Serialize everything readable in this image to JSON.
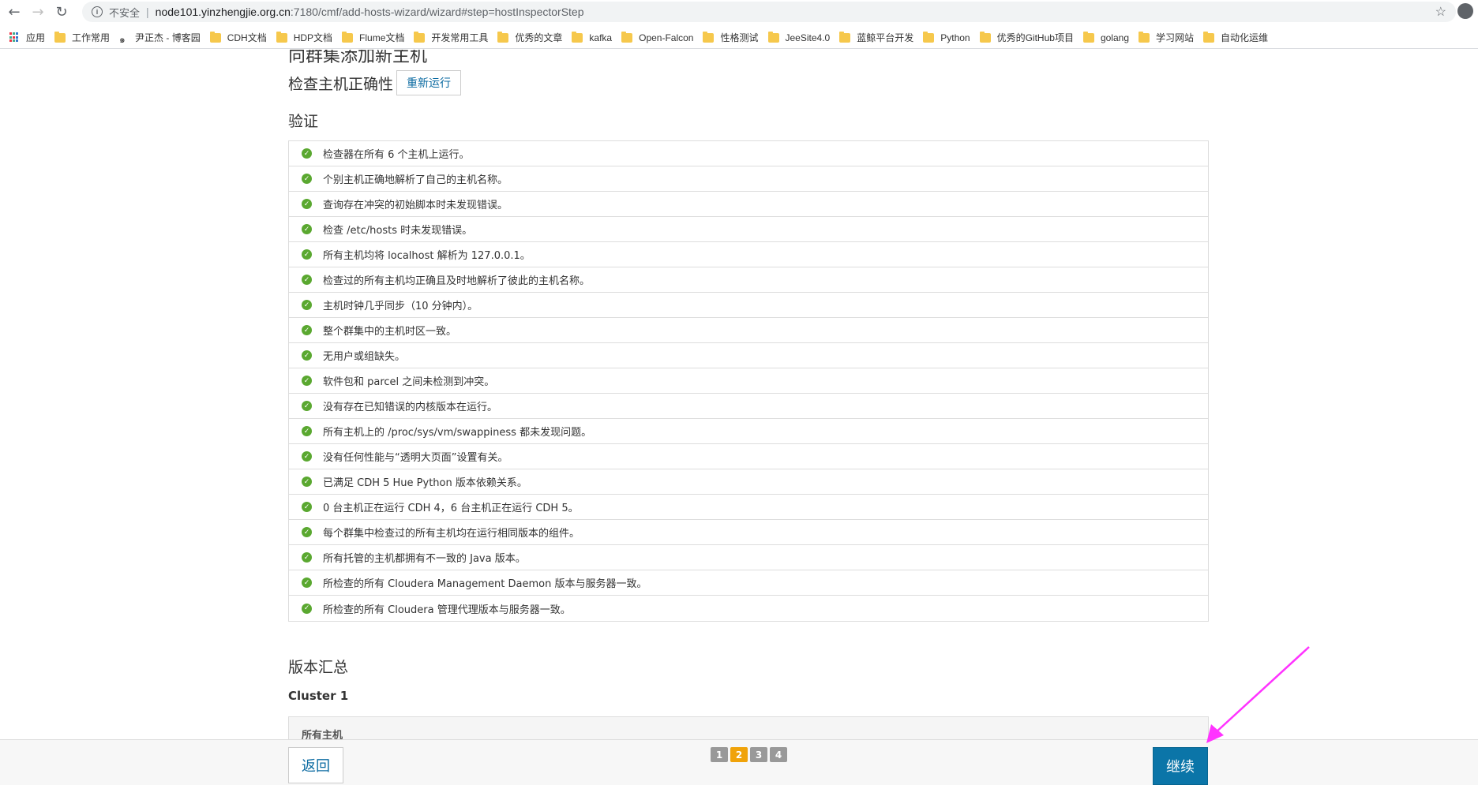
{
  "browser": {
    "insecure_label": "不安全",
    "url_host": "node101.yinzhengjie.org.cn",
    "url_path": ":7180/cmf/add-hosts-wizard/wizard#step=hostInspectorStep"
  },
  "bookmarks": [
    "应用",
    "工作常用",
    "尹正杰 - 博客园",
    "CDH文档",
    "HDP文档",
    "Flume文档",
    "开发常用工具",
    "优秀的文章",
    "kafka",
    "Open-Falcon",
    "性格测试",
    "JeeSite4.0",
    "蓝鲸平台开发",
    "Python",
    "优秀的GitHub项目",
    "golang",
    "学习网站",
    "自动化运维"
  ],
  "page": {
    "title": "向群集添加新主机",
    "subtitle": "检查主机正确性",
    "rerun_label": "重新运行",
    "validation_heading": "验证",
    "checks": [
      "检查器在所有 6 个主机上运行。",
      "个别主机正确地解析了自己的主机名称。",
      "查询存在冲突的初始脚本时未发现错误。",
      "检查 /etc/hosts 时未发现错误。",
      "所有主机均将 localhost 解析为 127.0.0.1。",
      "检查过的所有主机均正确且及时地解析了彼此的主机名称。",
      "主机时钟几乎同步（10 分钟内）。",
      "整个群集中的主机时区一致。",
      "无用户或组缺失。",
      "软件包和 parcel 之间未检测到冲突。",
      "没有存在已知错误的内核版本在运行。",
      "所有主机上的 /proc/sys/vm/swappiness 都未发现问题。",
      "没有任何性能与“透明大页面”设置有关。",
      "已满足 CDH 5 Hue Python 版本依赖关系。",
      "0 台主机正在运行 CDH 4，6 台主机正在运行 CDH 5。",
      "每个群集中检查过的所有主机均在运行相同版本的组件。",
      "所有托管的主机都拥有不一致的 Java 版本。",
      "所检查的所有 Cloudera Management Daemon 版本与服务器一致。",
      "所检查的所有 Cloudera 管理代理版本与服务器一致。"
    ],
    "version_heading": "版本汇总",
    "cluster_name": "Cluster 1",
    "all_hosts_label": "所有主机"
  },
  "footer": {
    "back_label": "返回",
    "continue_label": "继续",
    "steps": [
      "1",
      "2",
      "3",
      "4"
    ],
    "active_step": "2"
  },
  "colors": {
    "primary": "#0b75a8",
    "success": "#5aa830",
    "step_active": "#f0a30a",
    "annotation_arrow": "#ff33ff"
  }
}
